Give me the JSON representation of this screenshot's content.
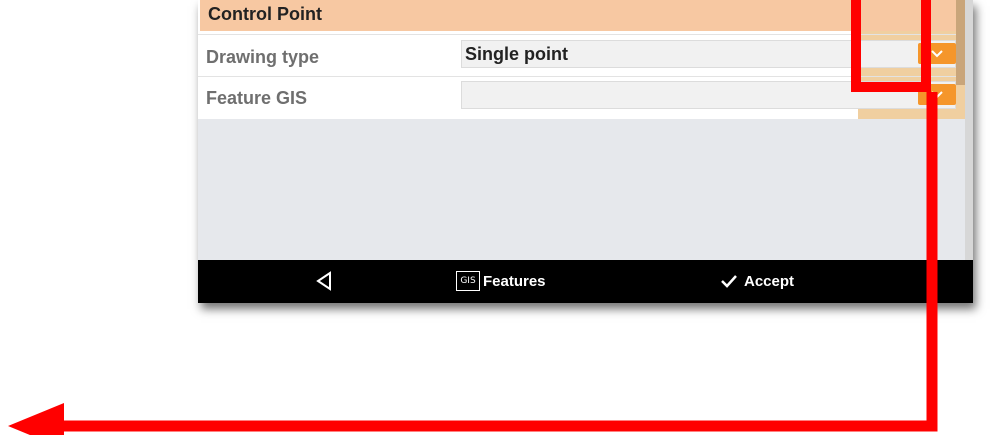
{
  "form": {
    "section_title": "Control Point",
    "rows": [
      {
        "label": "Drawing type",
        "value": "Single point"
      },
      {
        "label": "Feature GIS",
        "value": ""
      }
    ]
  },
  "bottom_bar": {
    "features_icon_text": "GIS",
    "features_label": "Features",
    "accept_label": "Accept",
    "icons": [
      "back-triangle-icon",
      "gis-icon",
      "checkmark-icon"
    ]
  },
  "annotation": {
    "highlight_color": "#ff0000",
    "arrow_direction": "left"
  },
  "colors": {
    "section_header": "#f7c8a2",
    "dropdown_button": "#f5962b",
    "bottom_bar": "#000000"
  }
}
